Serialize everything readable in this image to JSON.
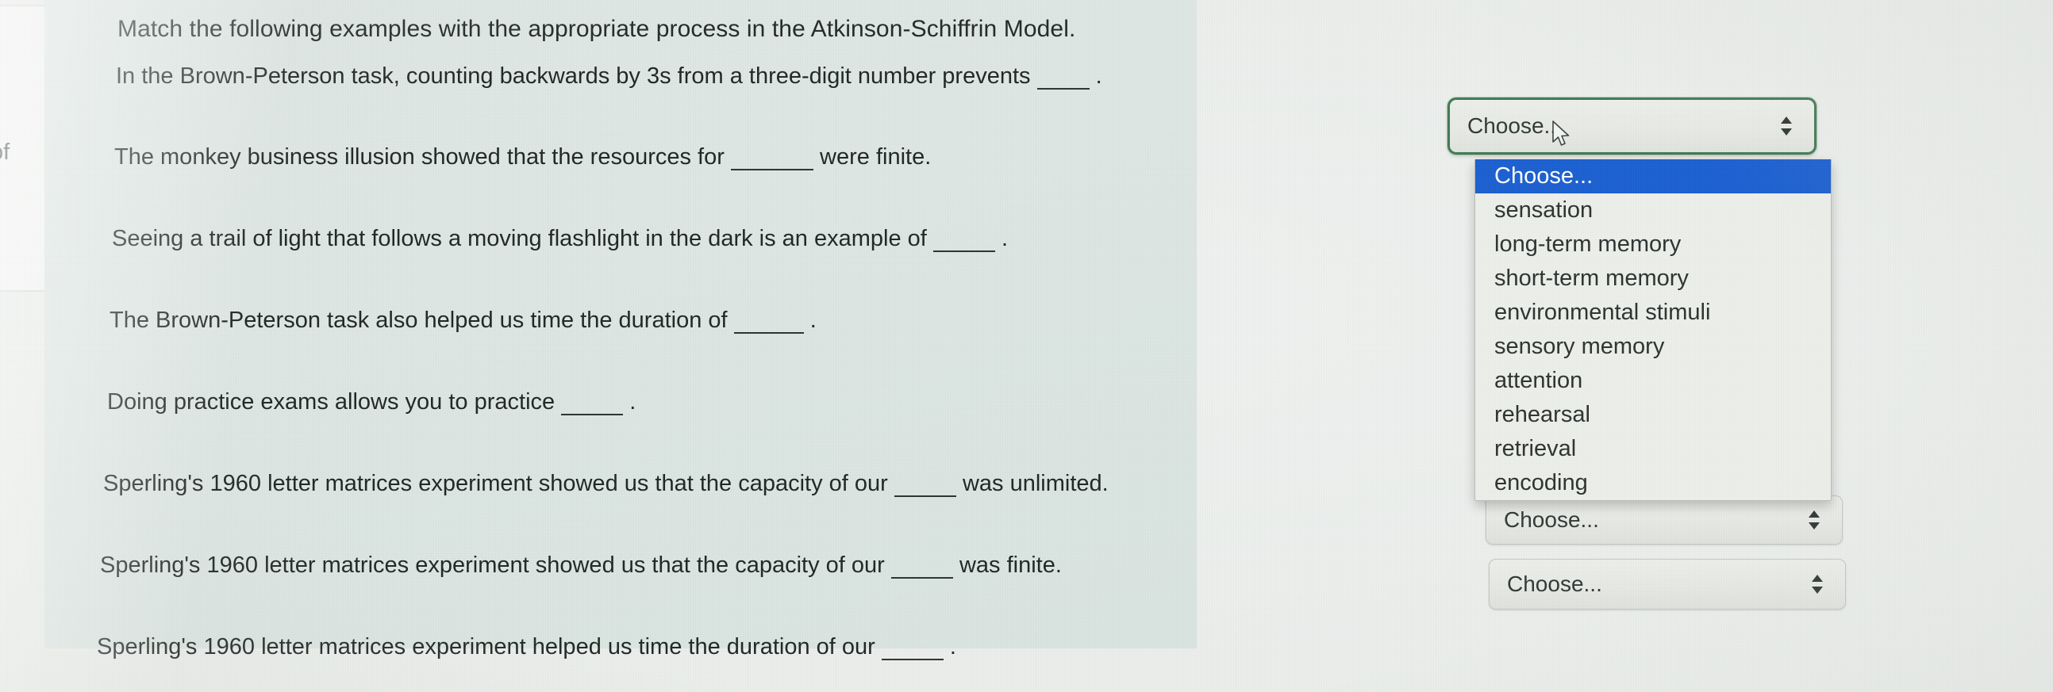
{
  "prompt": "Match the following examples with the appropriate process in the Atkinson-Schiffrin Model.",
  "left_panel": {
    "fragment_text": "of"
  },
  "questions": [
    {
      "before": "In the Brown-Peterson task, counting backwards by 3s from a three-digit number prevents",
      "blank_width": 66,
      "after": "."
    },
    {
      "before": "The monkey business illusion showed that the resources for",
      "blank_width": 104,
      "after": "were finite."
    },
    {
      "before": "Seeing a trail of light that follows a moving flashlight in the dark is an example of",
      "blank_width": 78,
      "after": "."
    },
    {
      "before": "The Brown-Peterson task also helped us time the duration of",
      "blank_width": 88,
      "after": "."
    },
    {
      "before": "Doing practice exams allows you to practice",
      "blank_width": 78,
      "after": "."
    },
    {
      "before": "Sperling's 1960 letter matrices experiment showed us that the capacity of our",
      "blank_width": 78,
      "after": "was unlimited."
    },
    {
      "before": "Sperling's 1960 letter matrices experiment showed us that the capacity of our",
      "blank_width": 78,
      "after": "was finite."
    },
    {
      "before": "Sperling's 1960 letter matrices experiment helped us time the duration of our",
      "blank_width": 78,
      "after": "."
    }
  ],
  "selects": {
    "open_select_value": "Choose...",
    "collapsed_values": [
      "Choose...",
      "Choose..."
    ],
    "options": [
      "Choose...",
      "sensation",
      "long-term memory",
      "short-term memory",
      "environmental stimuli",
      "sensory memory",
      "attention",
      "rehearsal",
      "retrieval",
      "encoding"
    ],
    "selected_option_index": 0
  },
  "colors": {
    "focus_ring": "#3f7a52",
    "highlight": "#1a5fd0",
    "card_background": "#dde6e3",
    "text": "#1e2623"
  }
}
